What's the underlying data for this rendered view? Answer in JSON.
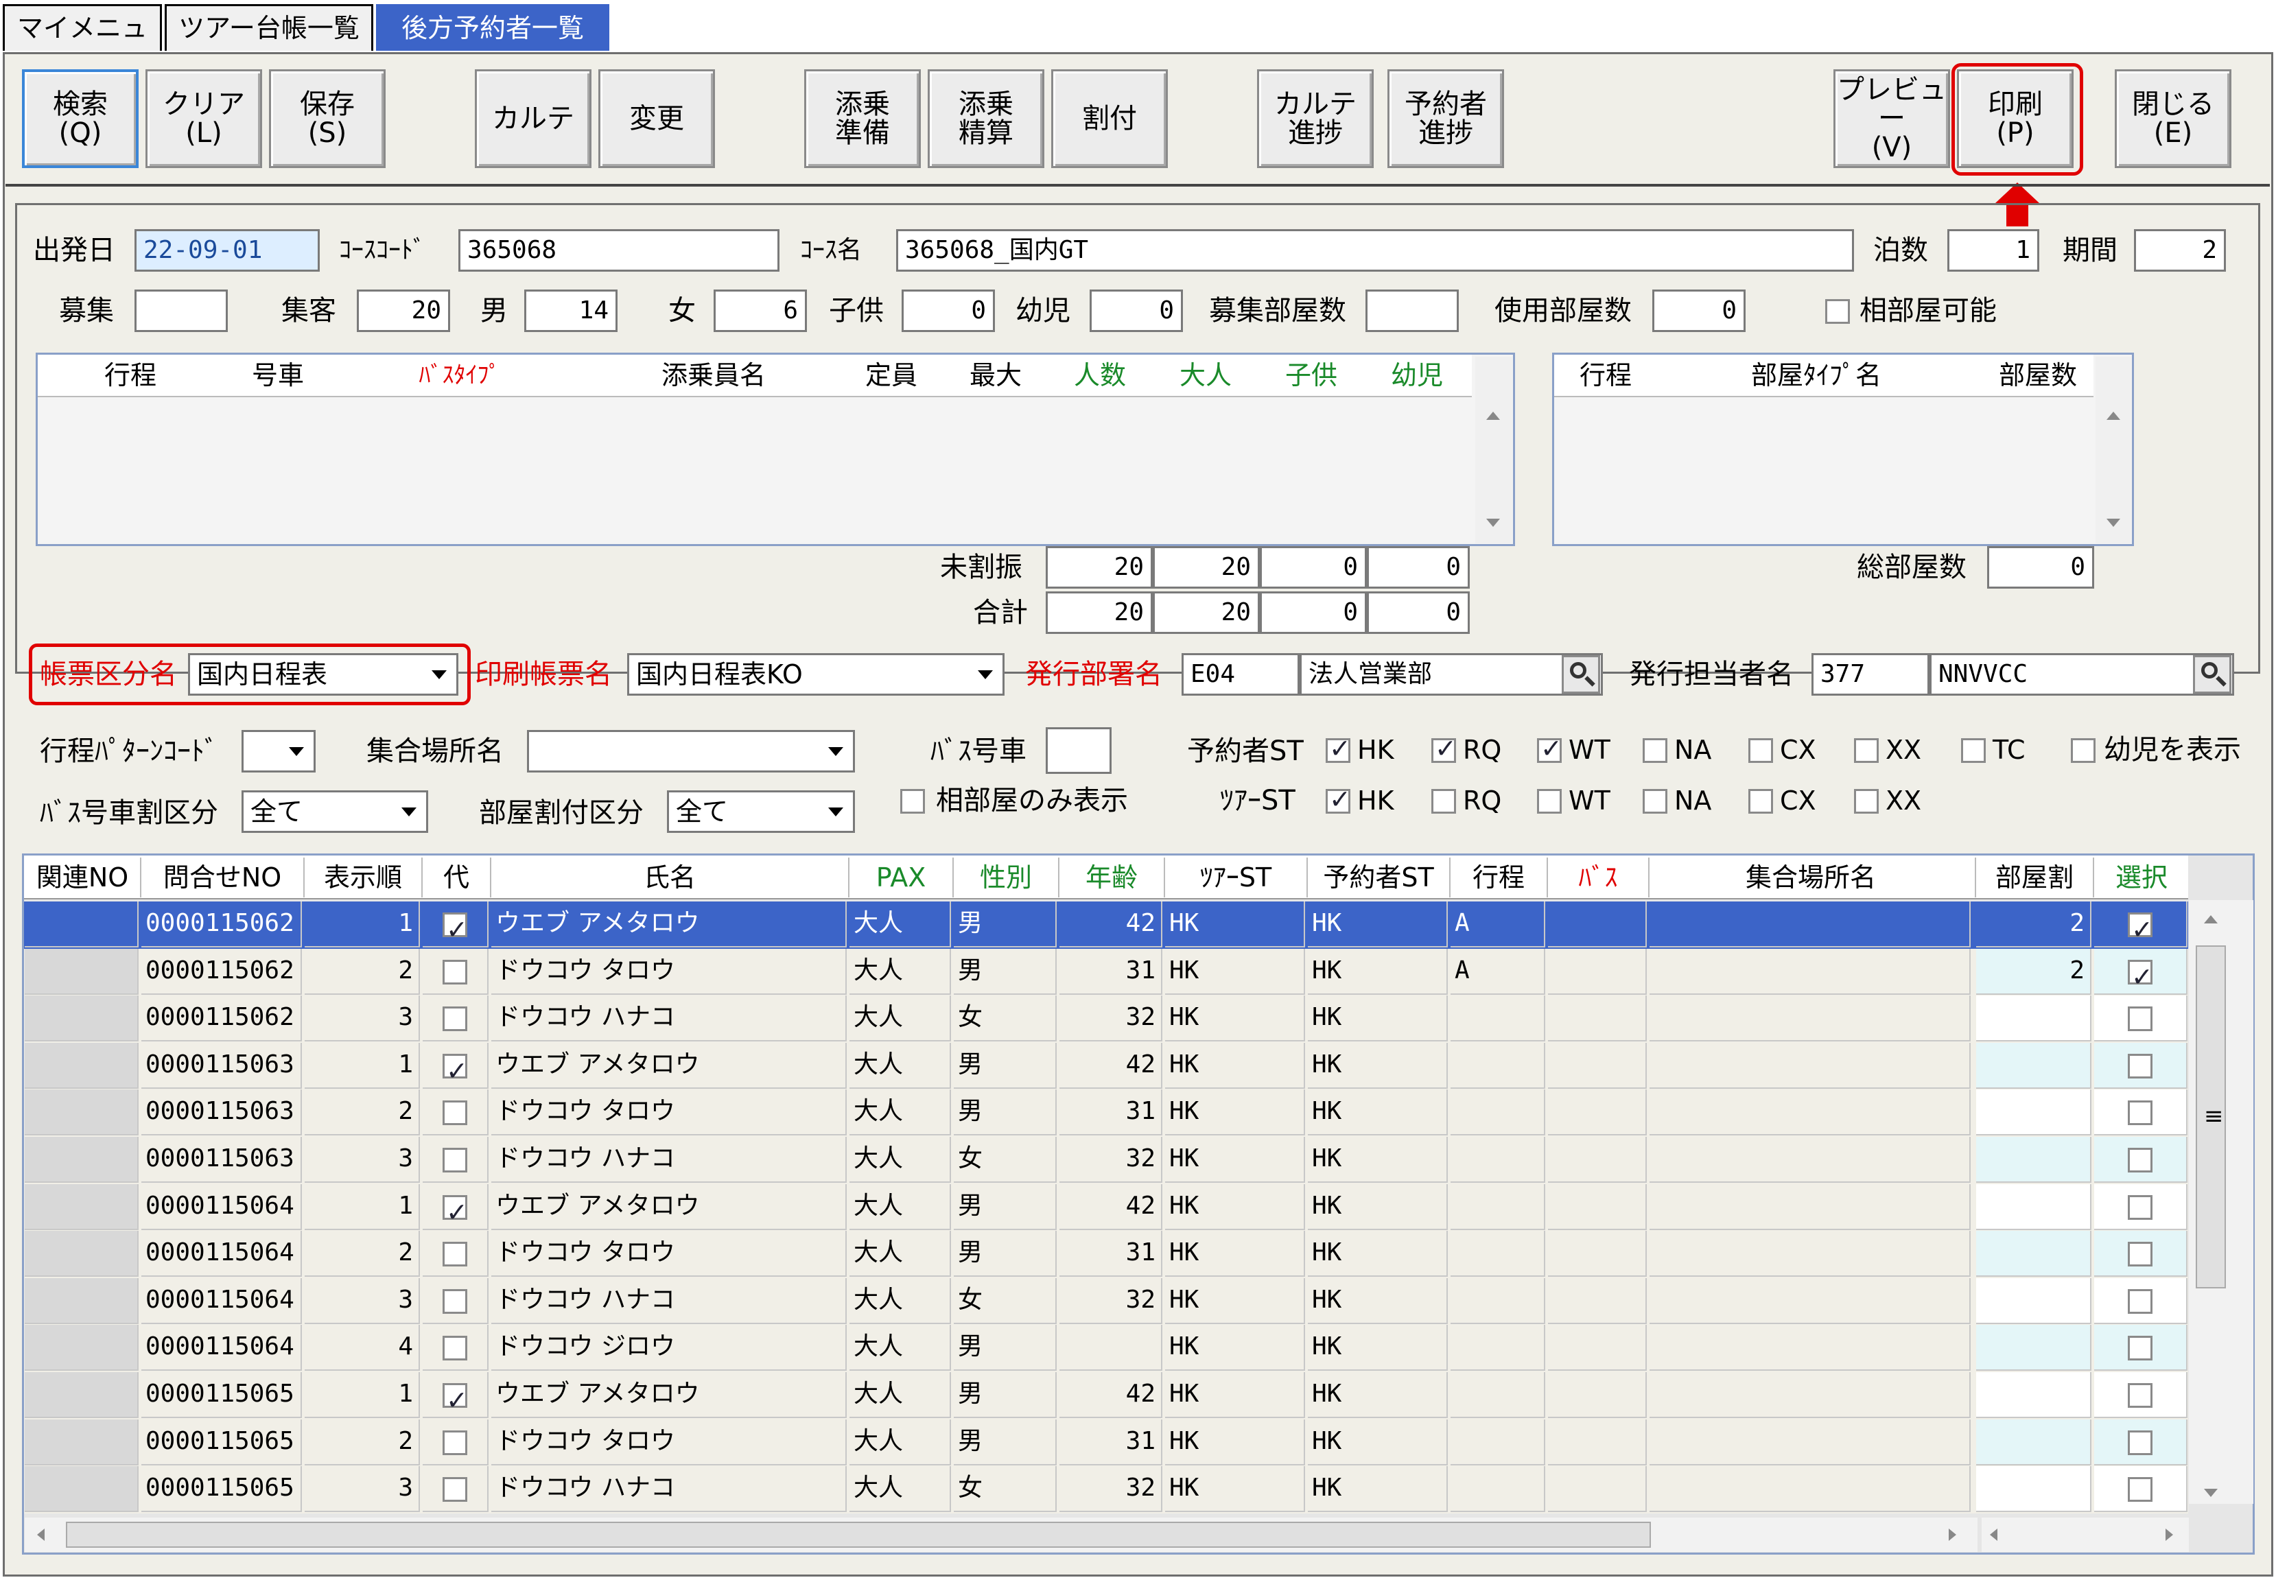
{
  "tabs": [
    "マイメニュー",
    "ツアー台帳一覧",
    "後方予約者一覧"
  ],
  "toolbar": [
    {
      "key": "search",
      "label": "検索\n(Q)"
    },
    {
      "key": "clear",
      "label": "クリア\n(L)"
    },
    {
      "key": "save",
      "label": "保存\n(S)"
    },
    {
      "key": "karte",
      "label": "カルテ"
    },
    {
      "key": "change",
      "label": "変更"
    },
    {
      "key": "tenjo-junbi",
      "label": "添乗\n準備"
    },
    {
      "key": "tenjo-seisan",
      "label": "添乗\n精算"
    },
    {
      "key": "waritsuke",
      "label": "割付"
    },
    {
      "key": "karte-shincho",
      "label": "カルテ\n進捗"
    },
    {
      "key": "yoyakusha-shincho",
      "label": "予約者\n進捗"
    },
    {
      "key": "preview",
      "label": "プレビュー\n(V)"
    },
    {
      "key": "print",
      "label": "印刷\n(P)"
    },
    {
      "key": "close",
      "label": "閉じる\n(E)"
    }
  ],
  "form": {
    "departure_label": "出発日",
    "departure_value": "22-09-01",
    "course_code_label": "ｺｰｽｺｰﾄﾞ",
    "course_code_value": "365068",
    "course_name_label": "ｺｰｽ名",
    "course_name_value": "365068_国内GT",
    "nights_label": "泊数",
    "nights_value": "1",
    "period_label": "期間",
    "period_value": "2",
    "recruit_label": "募集",
    "recruit_value": "",
    "gathered_label": "集客",
    "gathered_value": "20",
    "male_label": "男",
    "male_value": "14",
    "female_label": "女",
    "female_value": "6",
    "child_label": "子供",
    "child_value": "0",
    "infant_label": "幼児",
    "infant_value": "0",
    "recruit_rooms_label": "募集部屋数",
    "recruit_rooms_value": "",
    "used_rooms_label": "使用部屋数",
    "used_rooms_value": "0",
    "shared_room_label": "相部屋可能"
  },
  "bus_table": {
    "headers": [
      "行程",
      "号車",
      "ﾊﾞｽﾀｲﾌﾟ",
      "添乗員名",
      "定員",
      "最大",
      "人数",
      "大人",
      "子供",
      "幼児"
    ],
    "unassigned_label": "未割振",
    "unassigned": [
      "20",
      "20",
      "0",
      "0"
    ],
    "total_label": "合計",
    "total": [
      "20",
      "20",
      "0",
      "0"
    ]
  },
  "room_table": {
    "headers": [
      "行程",
      "部屋ﾀｲﾌﾟ名",
      "部屋数"
    ],
    "total_rooms_label": "総部屋数",
    "total_rooms_value": "0"
  },
  "print_row": {
    "form_category_label": "帳票区分名",
    "form_category_value": "国内日程表",
    "print_form_label": "印刷帳票名",
    "print_form_value": "国内日程表KO",
    "dept_label": "発行部署名",
    "dept_code": "E04",
    "dept_name": "法人営業部",
    "issuer_label": "発行担当者名",
    "issuer_code": "377",
    "issuer_name": "NNVVCC"
  },
  "filters": {
    "pattern_label": "行程ﾊﾟﾀｰﾝｺｰﾄﾞ",
    "meeting_place_label": "集合場所名",
    "bus_no_label": "ﾊﾞｽ号車",
    "bus_split_label": "ﾊﾞｽ号車割区分",
    "bus_split_value": "全て",
    "room_split_label": "部屋割付区分",
    "room_split_value": "全て",
    "shared_only_label": "相部屋のみ表示",
    "booker_st_label": "予約者ST",
    "tour_st_label": "ﾂｱｰST",
    "infant_show_label": "幼児を表示",
    "booker_st": [
      {
        "label": "HK",
        "checked": true
      },
      {
        "label": "RQ",
        "checked": true
      },
      {
        "label": "WT",
        "checked": true
      },
      {
        "label": "NA",
        "checked": false
      },
      {
        "label": "CX",
        "checked": false
      },
      {
        "label": "XX",
        "checked": false
      },
      {
        "label": "TC",
        "checked": false
      }
    ],
    "tour_st": [
      {
        "label": "HK",
        "checked": true
      },
      {
        "label": "RQ",
        "checked": false
      },
      {
        "label": "WT",
        "checked": false
      },
      {
        "label": "NA",
        "checked": false
      },
      {
        "label": "CX",
        "checked": false
      },
      {
        "label": "XX",
        "checked": false
      }
    ]
  },
  "grid": {
    "headers": [
      "関連NO",
      "問合せNO",
      "表示順",
      "代",
      "氏名",
      "PAX",
      "性別",
      "年齢",
      "ﾂｱｰST",
      "予約者ST",
      "行程",
      "ﾊﾞｽ",
      "集合場所名",
      "部屋割",
      "選択"
    ],
    "rows": [
      {
        "rel": "",
        "inq": "0000115062",
        "order": "1",
        "rep": true,
        "name": "ウエブ アメタロウ",
        "pax": "大人",
        "sex": "男",
        "age": "42",
        "tour_st": "HK",
        "booker_st": "HK",
        "course": "A",
        "bus": "",
        "place": "",
        "room": "2",
        "select": true
      },
      {
        "rel": "",
        "inq": "0000115062",
        "order": "2",
        "rep": false,
        "name": "ドウコウ タロウ",
        "pax": "大人",
        "sex": "男",
        "age": "31",
        "tour_st": "HK",
        "booker_st": "HK",
        "course": "A",
        "bus": "",
        "place": "",
        "room": "2",
        "select": true
      },
      {
        "rel": "",
        "inq": "0000115062",
        "order": "3",
        "rep": false,
        "name": "ドウコウ ハナコ",
        "pax": "大人",
        "sex": "女",
        "age": "32",
        "tour_st": "HK",
        "booker_st": "HK",
        "course": "",
        "bus": "",
        "place": "",
        "room": "",
        "select": false
      },
      {
        "rel": "",
        "inq": "0000115063",
        "order": "1",
        "rep": true,
        "name": "ウエブ アメタロウ",
        "pax": "大人",
        "sex": "男",
        "age": "42",
        "tour_st": "HK",
        "booker_st": "HK",
        "course": "",
        "bus": "",
        "place": "",
        "room": "",
        "select": false
      },
      {
        "rel": "",
        "inq": "0000115063",
        "order": "2",
        "rep": false,
        "name": "ドウコウ タロウ",
        "pax": "大人",
        "sex": "男",
        "age": "31",
        "tour_st": "HK",
        "booker_st": "HK",
        "course": "",
        "bus": "",
        "place": "",
        "room": "",
        "select": false
      },
      {
        "rel": "",
        "inq": "0000115063",
        "order": "3",
        "rep": false,
        "name": "ドウコウ ハナコ",
        "pax": "大人",
        "sex": "女",
        "age": "32",
        "tour_st": "HK",
        "booker_st": "HK",
        "course": "",
        "bus": "",
        "place": "",
        "room": "",
        "select": false
      },
      {
        "rel": "",
        "inq": "0000115064",
        "order": "1",
        "rep": true,
        "name": "ウエブ アメタロウ",
        "pax": "大人",
        "sex": "男",
        "age": "42",
        "tour_st": "HK",
        "booker_st": "HK",
        "course": "",
        "bus": "",
        "place": "",
        "room": "",
        "select": false
      },
      {
        "rel": "",
        "inq": "0000115064",
        "order": "2",
        "rep": false,
        "name": "ドウコウ タロウ",
        "pax": "大人",
        "sex": "男",
        "age": "31",
        "tour_st": "HK",
        "booker_st": "HK",
        "course": "",
        "bus": "",
        "place": "",
        "room": "",
        "select": false
      },
      {
        "rel": "",
        "inq": "0000115064",
        "order": "3",
        "rep": false,
        "name": "ドウコウ ハナコ",
        "pax": "大人",
        "sex": "女",
        "age": "32",
        "tour_st": "HK",
        "booker_st": "HK",
        "course": "",
        "bus": "",
        "place": "",
        "room": "",
        "select": false
      },
      {
        "rel": "",
        "inq": "0000115064",
        "order": "4",
        "rep": false,
        "name": "ドウコウ ジロウ",
        "pax": "大人",
        "sex": "男",
        "age": "",
        "tour_st": "HK",
        "booker_st": "HK",
        "course": "",
        "bus": "",
        "place": "",
        "room": "",
        "select": false
      },
      {
        "rel": "",
        "inq": "0000115065",
        "order": "1",
        "rep": true,
        "name": "ウエブ アメタロウ",
        "pax": "大人",
        "sex": "男",
        "age": "42",
        "tour_st": "HK",
        "booker_st": "HK",
        "course": "",
        "bus": "",
        "place": "",
        "room": "",
        "select": false
      },
      {
        "rel": "",
        "inq": "0000115065",
        "order": "2",
        "rep": false,
        "name": "ドウコウ タロウ",
        "pax": "大人",
        "sex": "男",
        "age": "31",
        "tour_st": "HK",
        "booker_st": "HK",
        "course": "",
        "bus": "",
        "place": "",
        "room": "",
        "select": false
      },
      {
        "rel": "",
        "inq": "0000115065",
        "order": "3",
        "rep": false,
        "name": "ドウコウ ハナコ",
        "pax": "大人",
        "sex": "女",
        "age": "32",
        "tour_st": "HK",
        "booker_st": "HK",
        "course": "",
        "bus": "",
        "place": "",
        "room": "",
        "select": false
      }
    ]
  },
  "colors": {
    "selected_row": "#3c64c8",
    "highlight": "#e00000",
    "accent_header": "#1a8a2a",
    "room_cell": "#e4f6f8"
  }
}
